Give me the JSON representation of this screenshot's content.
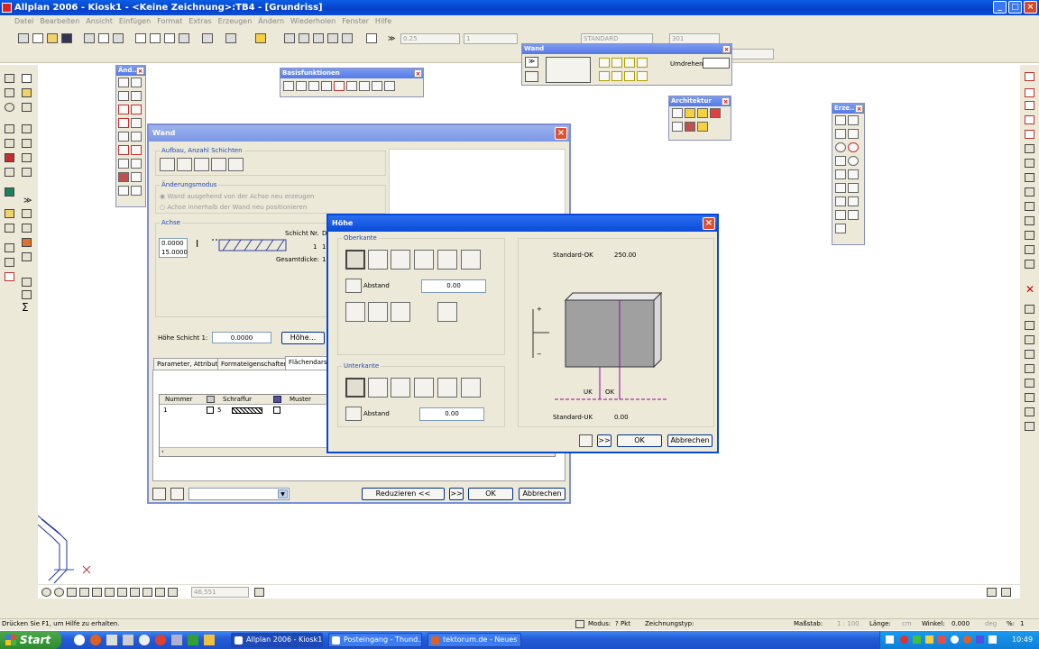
{
  "app": {
    "title": "Allplan 2006 - Kiosk1 - <Keine Zeichnung>:TB4 - [Grundriss]",
    "window_buttons": [
      "_",
      "□",
      "×"
    ]
  },
  "menu": [
    "Datei",
    "Bearbeiten",
    "Ansicht",
    "Einfügen",
    "Format",
    "Extras",
    "Erzeugen",
    "Ändern",
    "Wiederholen",
    "Fenster",
    "Hilfe"
  ],
  "toolbar": {
    "pen_thickness": "0.25",
    "line_type": "1",
    "layer": "STANDARD",
    "pattern": "301"
  },
  "palettes": {
    "aend": {
      "title": "Änd..."
    },
    "basis": {
      "title": "Basisfunktionen"
    },
    "wand_small": {
      "title": "Wand",
      "umdrehen_label": "Umdrehen"
    },
    "architektur": {
      "title": "Architektur"
    },
    "erze": {
      "title": "Erze..."
    }
  },
  "wand_dialog": {
    "title": "Wand",
    "group_aufbau": "Aufbau, Anzahl Schichten",
    "group_aenderungsmodus": "Änderungsmodus",
    "radio1": "Wand ausgehend von der Achse neu erzeugen",
    "radio2": "Achse innerhalb der Wand neu positionieren",
    "group_achse": "Achse",
    "achse_v1": "0.0000",
    "achse_v2": "15.0000",
    "schicht_nr_label": "Schicht Nr.",
    "schicht_d": "D",
    "schicht_value": "1",
    "schicht_15": "15",
    "gesamtdicke_label": "Gesamtdicke:",
    "gesamtdicke_value": "15",
    "hoehe_schicht_label": "Höhe Schicht 1:",
    "hoehe_schicht_value": "0.0000",
    "hoehe_button": "Höhe...",
    "tabs": [
      "Parameter, Attribute",
      "Formateigenschaften",
      "Flächendarst"
    ],
    "table_headers": [
      "Nummer",
      "Schraffur",
      "Muster"
    ],
    "table_row": {
      "nummer": "1",
      "schraffur": "5"
    },
    "reduzieren_button": "Reduzieren <<",
    "ok_button": "OK",
    "abbrechen_button": "Abbrechen",
    "more_button": ">>"
  },
  "hoehe_dialog": {
    "title": "Höhe",
    "oberkante_label": "Oberkante",
    "unterkante_label": "Unterkante",
    "abstand_label": "Abstand",
    "abstand_ok_value": "0.00",
    "abstand_uk_value": "0.00",
    "standard_ok_label": "Standard-OK",
    "standard_ok_value": "250.00",
    "standard_uk_label": "Standard-UK",
    "standard_uk_value": "0.00",
    "uk_label": "UK",
    "ok_label": "OK",
    "plus_sign": "+",
    "minus_sign": "−",
    "more_button": ">>",
    "ok_button": "OK",
    "abbrechen_button": "Abbrechen"
  },
  "canvas_bottom": {
    "zoom_value": "46.551"
  },
  "statusbar": {
    "help": "Drücken Sie F1, um Hilfe zu erhalten.",
    "modus_label": "Modus:",
    "modus_value": "? Pkt",
    "zeichnungstyp_label": "Zeichnungstyp:",
    "massstab_label": "Maßstab:",
    "massstab_value": "1 : 100",
    "laenge_label": "Länge:",
    "laenge_value": "cm",
    "winkel_label": "Winkel:",
    "winkel_value": "0.000",
    "winkel_unit": "deg",
    "prozent_label": "%:",
    "prozent_value": "1"
  },
  "taskbar": {
    "start": "Start",
    "tasks": [
      "Allplan 2006 - Kiosk1 ...",
      "Posteingang - Thund...",
      "tektorum.de - Neues ..."
    ],
    "clock": "10:49"
  },
  "colors": {
    "accent": "#0a4ad8",
    "title_inactive": "#7b97e4",
    "dialog_bg": "#ece9d8",
    "wall_fill": "#a0a0a0",
    "axis_line": "#a000a0"
  }
}
